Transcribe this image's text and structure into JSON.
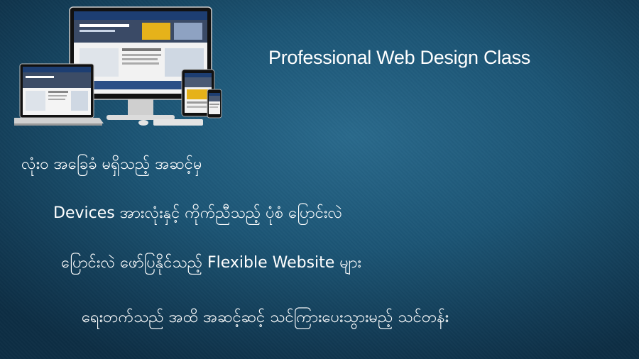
{
  "title": "Professional Web Design Class",
  "lines": [
    "လုံး၀ အခြေခံ မရှိသည့် အဆင့်မှ",
    "Devices အားလုံးနှင့် ကိုက်ညီသည့် ပုံစံ ပြောင်းလဲ",
    "ပြောင်းလဲ ဖော်ပြနိုင်သည့် Flexible Website များ",
    "ရေးတက်သည် အထိ အဆင့်ဆင့် သင်ကြားပေးသွားမည့် သင်တန်း"
  ],
  "devices": [
    "monitor",
    "laptop",
    "tablet",
    "phone"
  ]
}
